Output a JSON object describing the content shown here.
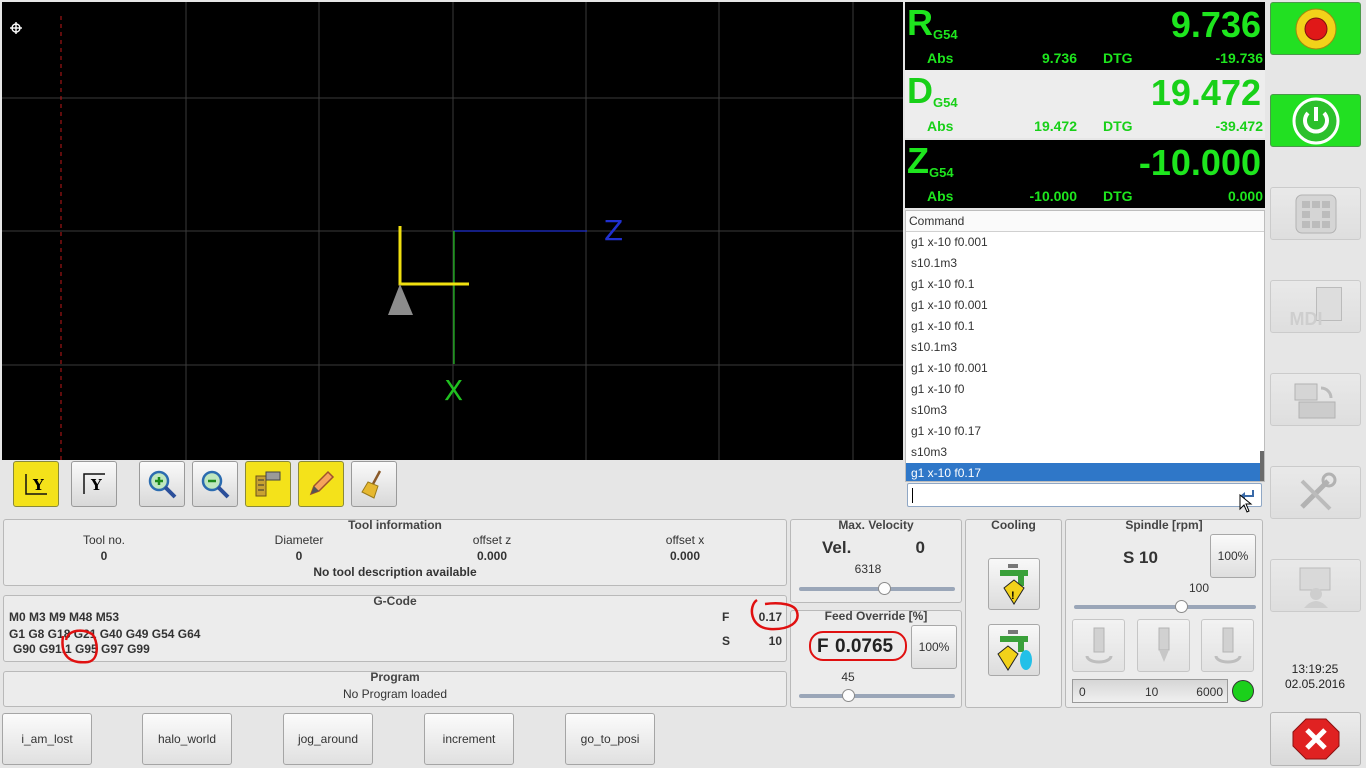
{
  "viewport": {
    "axis_z_label": "Z",
    "axis_x_label": "X"
  },
  "view_toolbar": {
    "icons": [
      "y-view-icon",
      "y-rotated-view-icon",
      "zoom-in-icon",
      "zoom-out-icon",
      "measure-icon",
      "pencil-icon",
      "clear-broom-icon"
    ]
  },
  "dro": [
    {
      "axis": "R",
      "sub": "G54",
      "value": "9.736",
      "abs_label": "Abs",
      "abs_value": "9.736",
      "dtg_label": "DTG",
      "dtg_value": "-19.736"
    },
    {
      "axis": "D",
      "sub": "G54",
      "value": "19.472",
      "abs_label": "Abs",
      "abs_value": "19.472",
      "dtg_label": "DTG",
      "dtg_value": "-39.472"
    },
    {
      "axis": "Z",
      "sub": "G54",
      "value": "-10.000",
      "abs_label": "Abs",
      "abs_value": "-10.000",
      "dtg_label": "DTG",
      "dtg_value": "0.000"
    }
  ],
  "history": {
    "header": "Command",
    "items": [
      "g1 x-10 f0.001",
      "s10.1m3",
      "g1 x-10 f0.1",
      "g1 x-10 f0.001",
      "g1 x-10 f0.1",
      "s10.1m3",
      "g1 x-10 f0.001",
      "g1 x-10 f0",
      "s10m3",
      "g1 x-10 f0.17",
      "s10m3",
      "g1 x-10 f0.17"
    ],
    "selected_index": 11,
    "input_value": ""
  },
  "tool_info": {
    "title": "Tool information",
    "tool_no_label": "Tool no.",
    "tool_no": "0",
    "diameter_label": "Diameter",
    "diameter": "0",
    "offset_z_label": "offset z",
    "offset_z": "0.000",
    "offset_x_label": "offset x",
    "offset_x": "0.000",
    "description": "No tool description available"
  },
  "gcode": {
    "title": "G-Code",
    "line1": "M0 M3 M9 M48 M53",
    "line2": "G1 G8 G18 G21 G40 G49 G54 G64",
    "line3": "G90 G91.1 G95 G97 G99",
    "f_label": "F",
    "f_value": "0.17",
    "s_label": "S",
    "s_value": "10"
  },
  "program": {
    "title": "Program",
    "status": "No Program loaded"
  },
  "max_velocity": {
    "title": "Max. Velocity",
    "vel_label": "Vel.",
    "vel_value": "0",
    "max_value": "6318",
    "level": 0.55
  },
  "feed_override": {
    "title": "Feed Override [%]",
    "f_label": "F",
    "f_value": "0.0765",
    "pct_button": "100%",
    "slider_value": "45",
    "level": 0.3
  },
  "cooling": {
    "title": "Cooling",
    "icons": [
      "coolant-mist-icon",
      "coolant-flood-icon"
    ]
  },
  "spindle": {
    "title": "Spindle [rpm]",
    "s_label": "S 10",
    "pct_button": "100%",
    "slider_value": "100",
    "level": 0.6,
    "bar_min": "0",
    "bar_cur": "10",
    "bar_max": "6000",
    "icons": [
      "spindle-ccw-icon",
      "spindle-stop-icon",
      "spindle-cw-icon"
    ]
  },
  "right_column": {
    "buttons": [
      "emergency-stop-icon",
      "power-on-icon",
      "jog-icon",
      "mdi-icon",
      "auto-program-icon",
      "settings-tools-icon",
      "user-icon",
      "close-app-icon"
    ],
    "mdi_text": "MDI"
  },
  "clock": {
    "time": "13:19:25",
    "date": "02.05.2016"
  },
  "macros": [
    "i_am_lost",
    "halo_world",
    "jog_around",
    "increment",
    "go_to_posi"
  ],
  "colors": {
    "dro_green": "#1ee61e",
    "selection": "#2f77c8",
    "annotation_red": "#e01010"
  }
}
